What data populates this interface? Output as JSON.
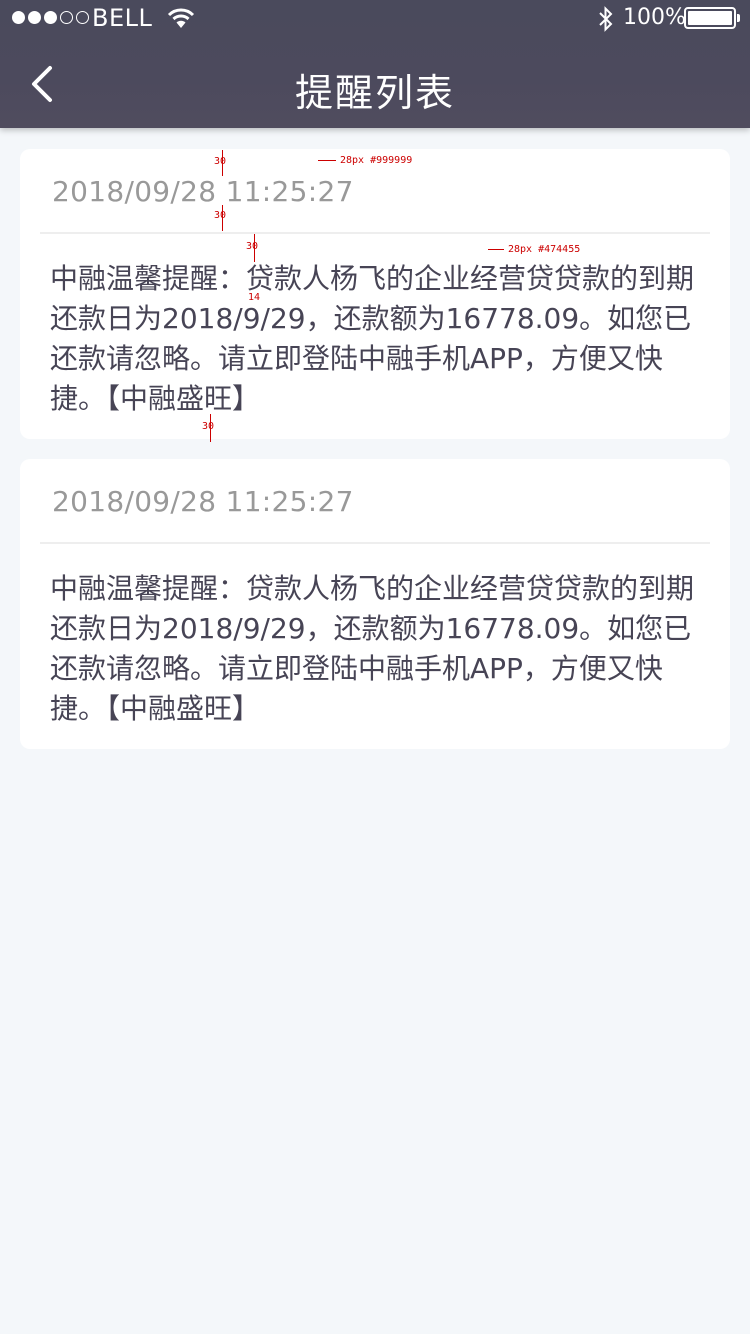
{
  "status_bar": {
    "carrier": "BELL",
    "battery_percent": "100%",
    "signal_bars": 3,
    "icons": [
      "wifi-icon",
      "bluetooth-icon",
      "battery-icon"
    ]
  },
  "nav": {
    "title": "提醒列表",
    "back_icon": "chevron-left-icon"
  },
  "reminders": [
    {
      "time": "2018/09/28 11:25:27",
      "message": "中融温馨提醒：贷款人杨飞的企业经营贷贷款的到期还款日为2018/9/29，还款额为16778.09。如您已还款请忽略。请立即登陆中融手机APP，方便又快捷。【中融盛旺】"
    },
    {
      "time": "2018/09/28 11:25:27",
      "message": "中融温馨提醒：贷款人杨飞的企业经营贷贷款的到期还款日为2018/9/29，还款额为16778.09。如您已还款请忽略。请立即登陆中融手机APP，方便又快捷。【中融盛旺】"
    }
  ],
  "annotations": {
    "time_font": "28px #999999",
    "body_font": "28px #474455",
    "gap_30": "30",
    "gap_14": "14"
  },
  "colors": {
    "header_bg": "#4c4a5d",
    "page_bg": "#f4f7fa",
    "time_text": "#999999",
    "body_text": "#474455",
    "annotation": "#cc0000"
  }
}
